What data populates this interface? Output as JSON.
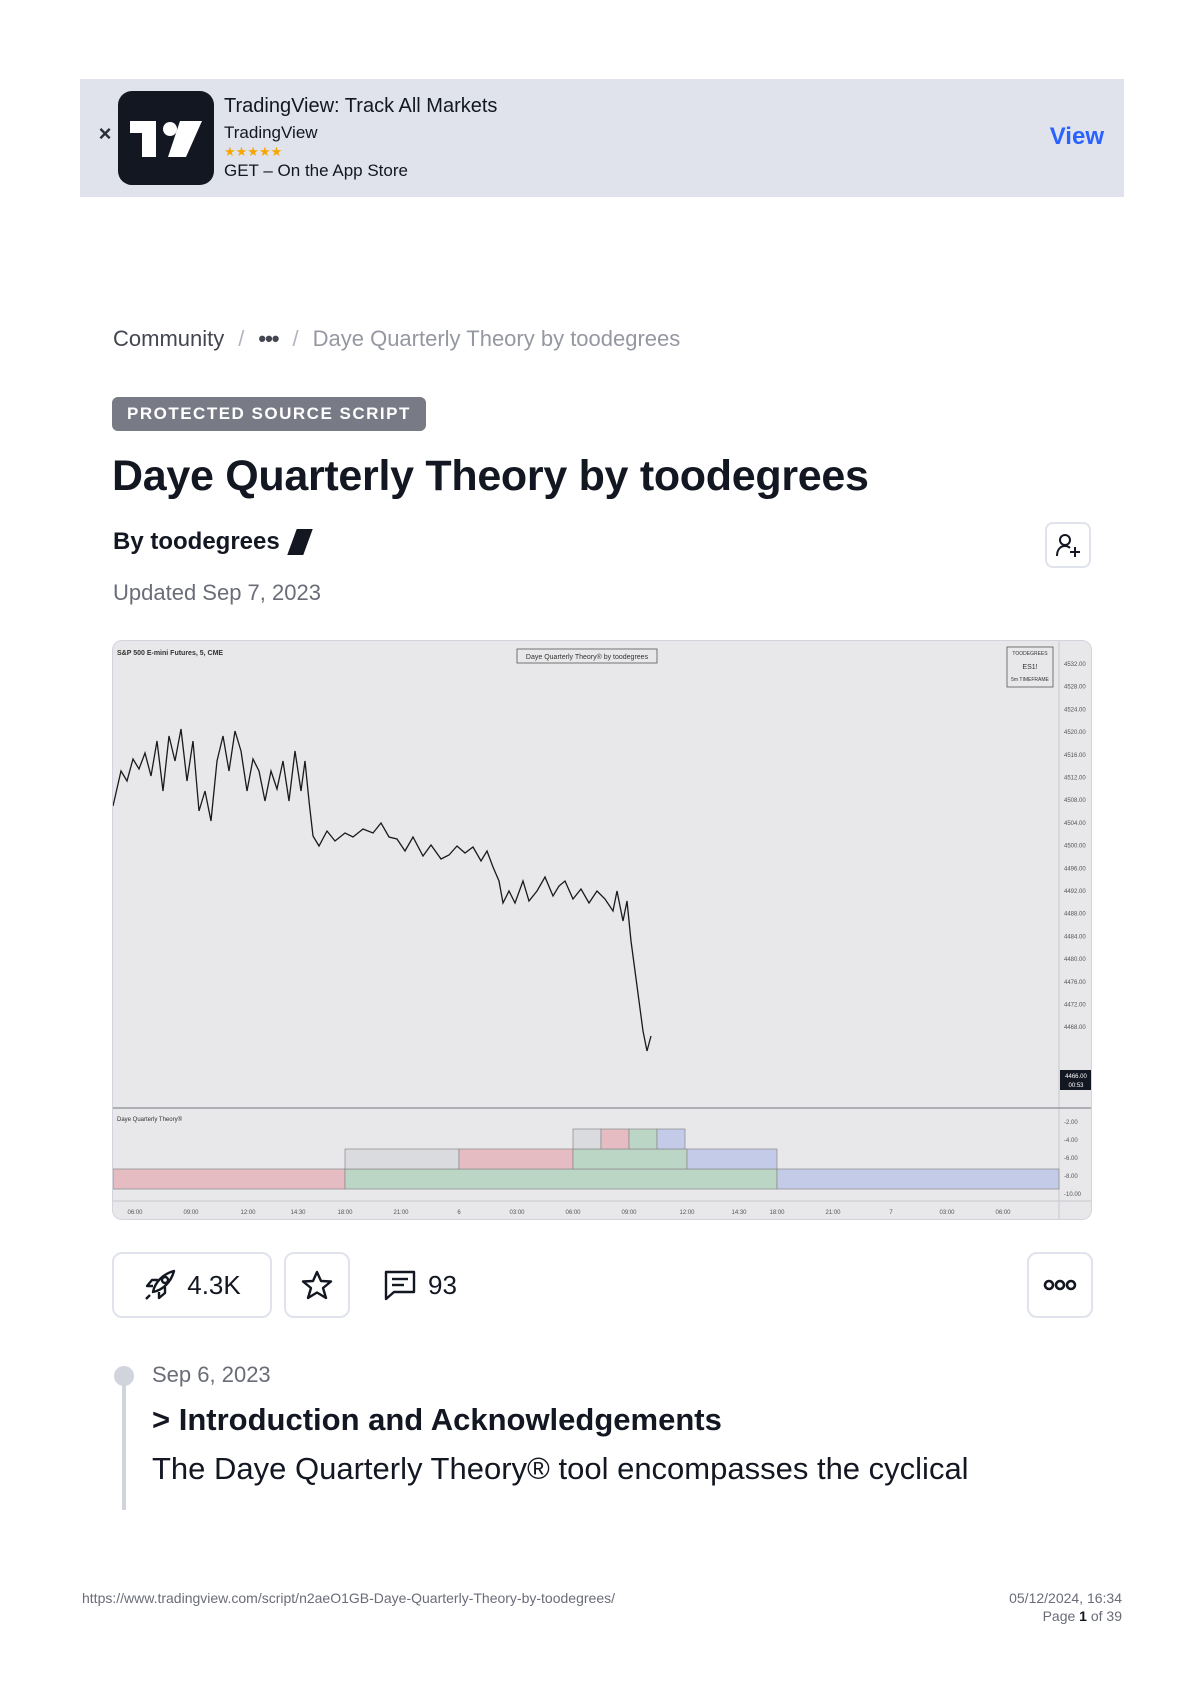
{
  "banner": {
    "app_title": "TradingView: Track All Markets",
    "developer": "TradingView",
    "stars": "★★★★★",
    "get_text": "GET – On the App Store",
    "view_label": "View",
    "close_glyph": "×"
  },
  "breadcrumb": {
    "community": "Community",
    "separator": "/",
    "ellipsis": "•••",
    "current": "Daye Quarterly Theory by toodegrees"
  },
  "badge": "PROTECTED SOURCE SCRIPT",
  "title": "Daye Quarterly Theory by toodegrees",
  "author": "By toodegrees",
  "updated": "Updated Sep 7, 2023",
  "chart": {
    "symbol": "S&P 500 E-mini Futures, 5, CME",
    "indicator_title": "Daye Quarterly Theory® by toodegrees",
    "watermark_line1": "TOODEGREES",
    "watermark_line2": "ES1!",
    "watermark_line3": "5m TIMEFRAME",
    "price_ticks": [
      "4532.00",
      "4528.00",
      "4524.00",
      "4520.00",
      "4516.00",
      "4512.00",
      "4508.00",
      "4504.00",
      "4500.00",
      "4496.00",
      "4492.00",
      "4488.00",
      "4484.00",
      "4480.00",
      "4476.00",
      "4472.00",
      "4468.00"
    ],
    "last_price": "4466.00",
    "last_price_timer": "00:53",
    "pane_title": "Daye Quarterly Theory®",
    "pane_ticks": [
      "-2.00",
      "-4.00",
      "-6.00",
      "-8.00",
      "-10.00"
    ],
    "time_ticks": [
      "06:00",
      "09:00",
      "12:00",
      "14:30",
      "18:00",
      "21:00",
      "6",
      "03:00",
      "06:00",
      "09:00",
      "12:00",
      "14:30",
      "18:00",
      "21:00",
      "7",
      "03:00",
      "06:00"
    ]
  },
  "actions": {
    "boosts": "4.3K",
    "comments": "93"
  },
  "timeline": {
    "date": "Sep 6, 2023",
    "heading": "> Introduction and Acknowledgements",
    "body": "The Daye Quarterly Theory® tool encompasses the cyclical"
  },
  "footer": {
    "url": "https://www.tradingview.com/script/n2aeO1GB-Daye-Quarterly-Theory-by-toodegrees/",
    "datetime": "05/12/2024, 16:34",
    "page_prefix": "Page ",
    "page_num": "1",
    "page_suffix": " of 39"
  },
  "colors": {
    "accent": "#2962ff",
    "stars": "#f7a600",
    "badge": "#787b86"
  }
}
